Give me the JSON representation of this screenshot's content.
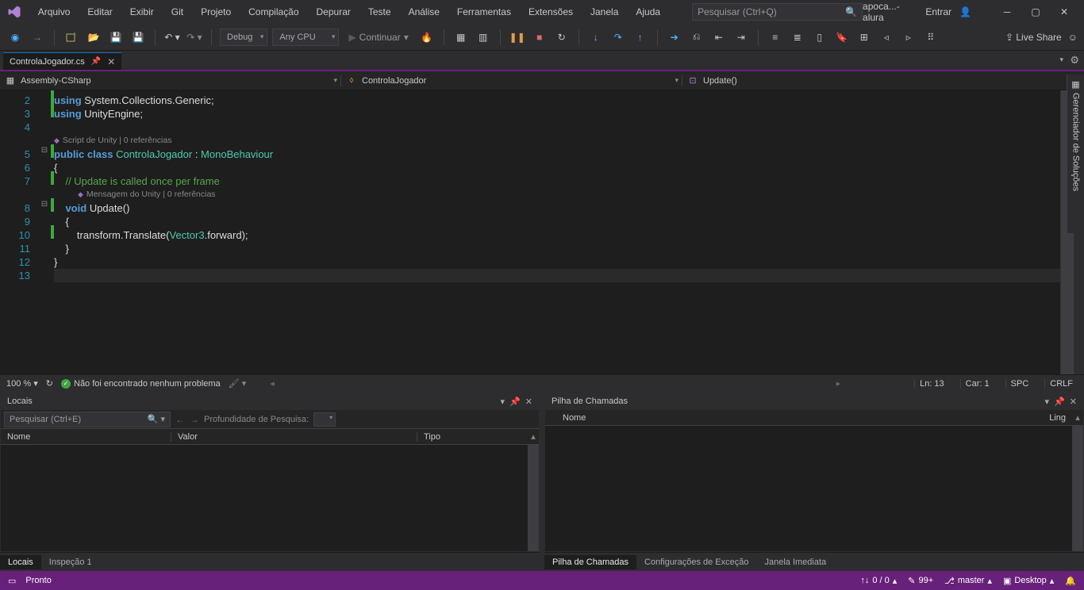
{
  "menu": {
    "arquivo": "Arquivo",
    "editar": "Editar",
    "exibir": "Exibir",
    "git": "Git",
    "projeto": "Projeto",
    "compilacao": "Compilação",
    "depurar": "Depurar",
    "teste": "Teste",
    "analise": "Análise",
    "ferramentas": "Ferramentas",
    "extensoes": "Extensões",
    "janela": "Janela",
    "ajuda": "Ajuda"
  },
  "search": {
    "placeholder": "Pesquisar (Ctrl+Q)"
  },
  "account": {
    "project": "apoca...-alura",
    "signin": "Entrar"
  },
  "toolbar": {
    "config_debug": "Debug",
    "config_platform": "Any CPU",
    "continue": "Continuar",
    "liveshare": "Live Share"
  },
  "tab": {
    "filename": "ControlaJogador.cs"
  },
  "nav": {
    "assembly": "Assembly-CSharp",
    "class": "ControlaJogador",
    "member": "Update()"
  },
  "side": {
    "solution": "Gerenciador de Soluções"
  },
  "gutter": {
    "l2": "2",
    "l3": "3",
    "l4": "4",
    "l5": "5",
    "l6": "6",
    "l7": "7",
    "l8": "8",
    "l9": "9",
    "l10": "10",
    "l11": "11",
    "l12": "12",
    "l13": "13"
  },
  "code": {
    "using": "using",
    "syscol": "System.Collections.Generic",
    "unity": "UnityEngine",
    "lens1": "Script de Unity | 0 referências",
    "public": "public",
    "class": "class",
    "cls": "ControlaJogador",
    "mono": "MonoBehaviour",
    "comment": "// Update is called once per frame",
    "lens2": "Mensagem do Unity | 0 referências",
    "void": "void",
    "update": "Update",
    "transform": "transform",
    "translate": "Translate",
    "vector3": "Vector3",
    "forward": "forward"
  },
  "editorStatus": {
    "zoom": "100 %",
    "problems": "Não foi encontrado nenhum problema",
    "ln": "Ln: 13",
    "car": "Car: 1",
    "spc": "SPC",
    "crlf": "CRLF"
  },
  "locals": {
    "title": "Locais",
    "search_ph": "Pesquisar (Ctrl+E)",
    "depth_lbl": "Profundidade de Pesquisa:",
    "col_nome": "Nome",
    "col_valor": "Valor",
    "col_tipo": "Tipo",
    "tab_locais": "Locais",
    "tab_insp": "Inspeção 1"
  },
  "callstack": {
    "title": "Pilha de Chamadas",
    "col_nome": "Nome",
    "col_ling": "Ling",
    "tab_pilha": "Pilha de Chamadas",
    "tab_exc": "Configurações de Exceção",
    "tab_janela": "Janela Imediata"
  },
  "status": {
    "ready": "Pronto",
    "errwarn": "0 / 0",
    "changes": "99+",
    "branch": "master",
    "desktop": "Desktop"
  }
}
